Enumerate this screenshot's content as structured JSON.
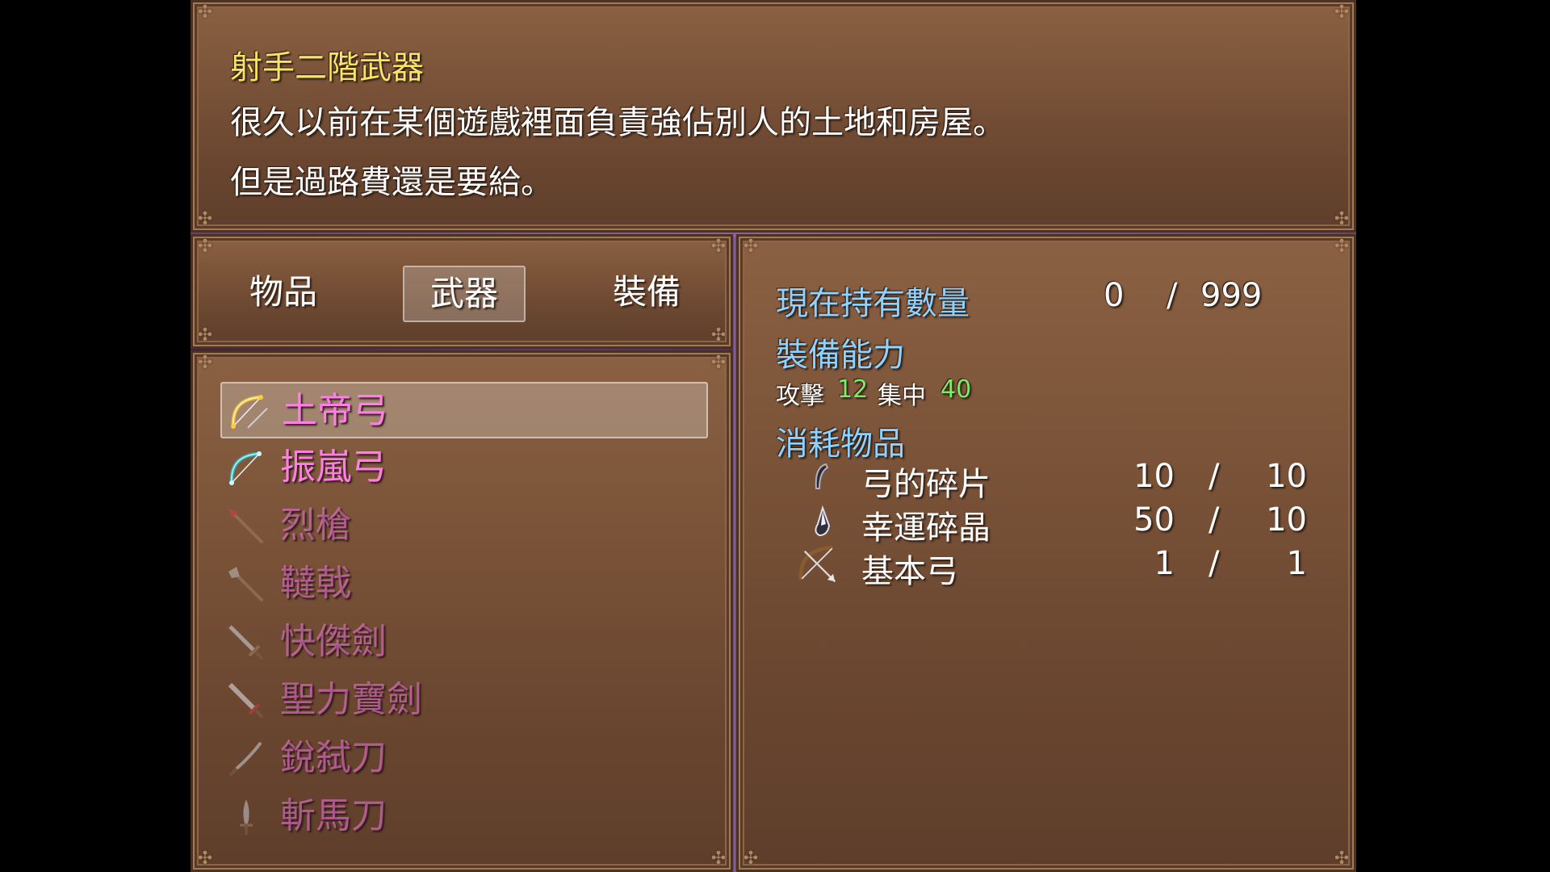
{
  "help": {
    "title": "射手二階武器",
    "line1": "很久以前在某個遊戲裡面負責強佔別人的土地和房屋。",
    "line2": "但是過路費還是要給。"
  },
  "categories": {
    "items": "物品",
    "weapons": "武器",
    "equipment": "裝備",
    "selected": "武器"
  },
  "item_list": [
    {
      "name": "土帝弓",
      "icon": "golden-bow-icon",
      "enabled": true,
      "selected": true
    },
    {
      "name": "振嵐弓",
      "icon": "teal-bow-icon",
      "enabled": true,
      "selected": false
    },
    {
      "name": "烈槍",
      "icon": "red-spear-icon",
      "enabled": false,
      "selected": false
    },
    {
      "name": "韃戟",
      "icon": "halberd-icon",
      "enabled": false,
      "selected": false
    },
    {
      "name": "快傑劍",
      "icon": "sword-icon",
      "enabled": false,
      "selected": false
    },
    {
      "name": "聖力寶劍",
      "icon": "holy-sword-icon",
      "enabled": false,
      "selected": false
    },
    {
      "name": "銳弑刀",
      "icon": "katana-icon",
      "enabled": false,
      "selected": false
    },
    {
      "name": "斬馬刀",
      "icon": "broadsword-icon",
      "enabled": false,
      "selected": false
    }
  ],
  "detail": {
    "owned_label": "現在持有數量",
    "owned_count": "0",
    "owned_slash": "/",
    "owned_max": "999",
    "ability_label": "裝備能力",
    "stats": {
      "atk_label": "攻擊",
      "atk_value": "12",
      "focus_label": "集中",
      "focus_value": "40"
    },
    "consume_label": "消耗物品",
    "materials": [
      {
        "name": "弓的碎片",
        "icon": "bow-shard-icon",
        "have": "10",
        "slash": "/",
        "need": "10"
      },
      {
        "name": "幸運碎晶",
        "icon": "lucky-crystal-icon",
        "have": "50",
        "slash": "/",
        "need": "10"
      },
      {
        "name": "基本弓",
        "icon": "basic-bow-icon",
        "have": "1",
        "slash": "/",
        "need": "1"
      }
    ]
  },
  "colors": {
    "title_yellow": "#f6e36a",
    "label_blue": "#8fd2ff",
    "item_pink": "#ff7ee8",
    "stat_green": "#7cea6a"
  }
}
